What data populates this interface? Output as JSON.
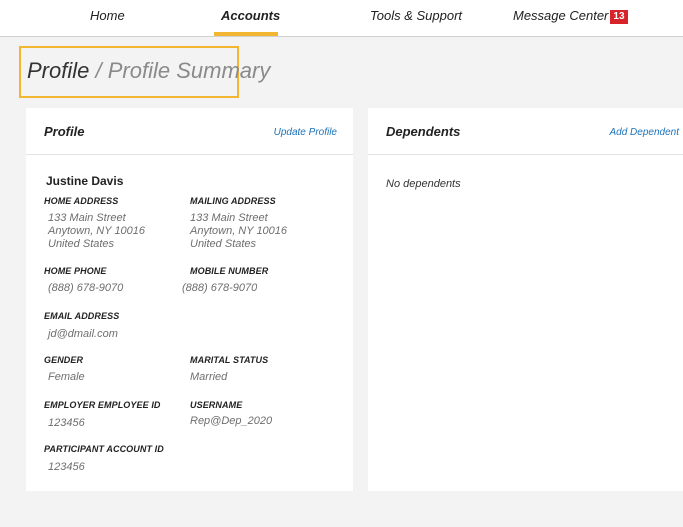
{
  "nav": {
    "items": [
      {
        "label": "Home"
      },
      {
        "label": "Accounts"
      },
      {
        "label": "Tools & Support"
      },
      {
        "label": "Message Center"
      }
    ],
    "message_count": "13",
    "accent_color": "#f2b632",
    "badge_color": "#d8232a"
  },
  "page": {
    "title": "Profile",
    "separator": "/",
    "subtitle": "Profile Summary"
  },
  "profile_card": {
    "title": "Profile",
    "update_link": "Update Profile",
    "name": "Justine Davis",
    "home_address": {
      "label": "HOME ADDRESS",
      "lines": [
        "133 Main Street",
        "Anytown, NY 10016",
        "United States"
      ]
    },
    "mailing_address": {
      "label": "MAILING ADDRESS",
      "lines": [
        "133 Main Street",
        "Anytown, NY 10016",
        "United States"
      ]
    },
    "home_phone": {
      "label": "HOME PHONE",
      "value": "(888) 678-9070"
    },
    "mobile_number": {
      "label": "MOBILE NUMBER",
      "value": "(888) 678-9070"
    },
    "email": {
      "label": "EMAIL ADDRESS",
      "value": "jd@dmail.com"
    },
    "gender": {
      "label": "GENDER",
      "value": "Female"
    },
    "marital_status": {
      "label": "MARITAL STATUS",
      "value": "Married"
    },
    "employer_employee_id": {
      "label": "EMPLOYER EMPLOYEE ID",
      "value": "123456"
    },
    "username": {
      "label": "USERNAME",
      "value": "Rep@Dep_2020"
    },
    "participant_account_id": {
      "label": "PARTICIPANT ACCOUNT ID",
      "value": "123456"
    }
  },
  "dependents_card": {
    "title": "Dependents",
    "add_link": "Add Dependent",
    "empty_text": "No dependents"
  }
}
